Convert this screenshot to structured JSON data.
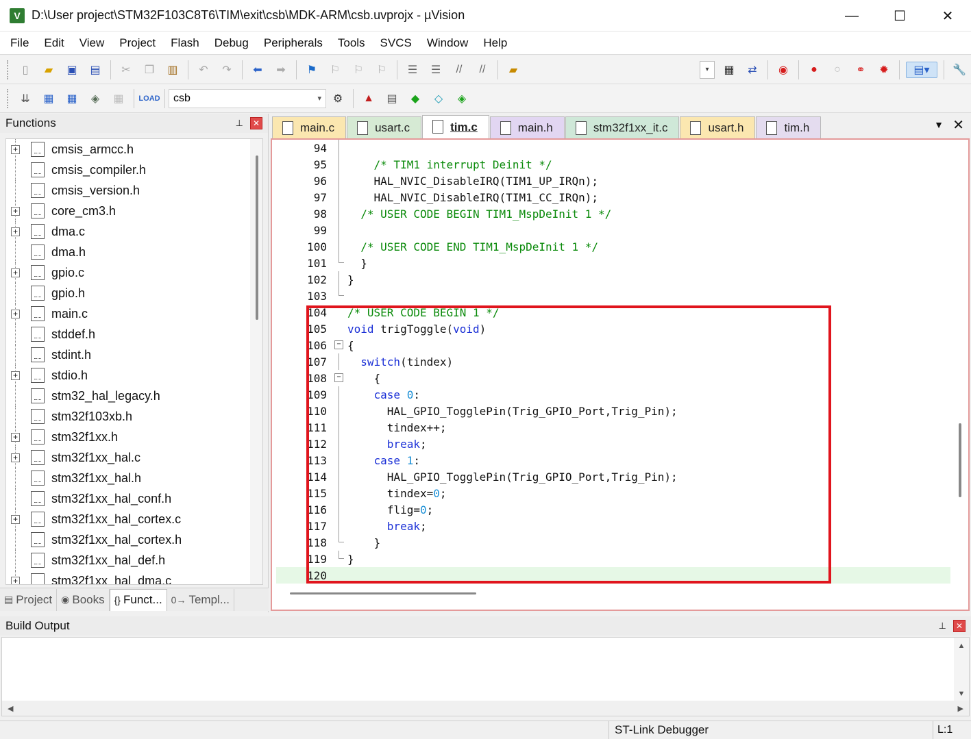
{
  "window": {
    "title": "D:\\User project\\STM32F103C8T6\\TIM\\exit\\csb\\MDK-ARM\\csb.uvprojx - µVision",
    "minimize": "—",
    "maximize": "☐",
    "close": "✕"
  },
  "menu": [
    "File",
    "Edit",
    "View",
    "Project",
    "Flash",
    "Debug",
    "Peripherals",
    "Tools",
    "SVCS",
    "Window",
    "Help"
  ],
  "toolbar": {
    "target_name": "csb"
  },
  "functions_panel": {
    "title": "Functions",
    "pin": "⊥",
    "close": "✕",
    "files": [
      {
        "name": "cmsis_armcc.h",
        "expandable": true
      },
      {
        "name": "cmsis_compiler.h",
        "expandable": false
      },
      {
        "name": "cmsis_version.h",
        "expandable": false
      },
      {
        "name": "core_cm3.h",
        "expandable": true
      },
      {
        "name": "dma.c",
        "expandable": true
      },
      {
        "name": "dma.h",
        "expandable": false
      },
      {
        "name": "gpio.c",
        "expandable": true
      },
      {
        "name": "gpio.h",
        "expandable": false
      },
      {
        "name": "main.c",
        "expandable": true
      },
      {
        "name": "stddef.h",
        "expandable": false
      },
      {
        "name": "stdint.h",
        "expandable": false
      },
      {
        "name": "stdio.h",
        "expandable": true
      },
      {
        "name": "stm32_hal_legacy.h",
        "expandable": false
      },
      {
        "name": "stm32f103xb.h",
        "expandable": false
      },
      {
        "name": "stm32f1xx.h",
        "expandable": true
      },
      {
        "name": "stm32f1xx_hal.c",
        "expandable": true
      },
      {
        "name": "stm32f1xx_hal.h",
        "expandable": false
      },
      {
        "name": "stm32f1xx_hal_conf.h",
        "expandable": false
      },
      {
        "name": "stm32f1xx_hal_cortex.c",
        "expandable": true
      },
      {
        "name": "stm32f1xx_hal_cortex.h",
        "expandable": false
      },
      {
        "name": "stm32f1xx_hal_def.h",
        "expandable": false
      },
      {
        "name": "stm32f1xx_hal_dma.c",
        "expandable": true
      }
    ],
    "tabs": [
      {
        "label": "Project",
        "icon": "▤"
      },
      {
        "label": "Books",
        "icon": "◉"
      },
      {
        "label": "Funct...",
        "icon": "{}"
      },
      {
        "label": "Templ...",
        "icon": "0→"
      }
    ]
  },
  "editor": {
    "tabs": [
      {
        "label": "main.c",
        "color": "#fbe7b0",
        "active": false
      },
      {
        "label": "usart.c",
        "color": "#d6ead4",
        "active": false
      },
      {
        "label": "tim.c",
        "color": "#ffffff",
        "active": true
      },
      {
        "label": "main.h",
        "color": "#e2d6f2",
        "active": false
      },
      {
        "label": "stm32f1xx_it.c",
        "color": "#cfe8d8",
        "active": false
      },
      {
        "label": "usart.h",
        "color": "#fbe7b0",
        "active": false
      },
      {
        "label": "tim.h",
        "color": "#e4dcef",
        "active": false
      }
    ],
    "tab_menu": "▼",
    "tab_close": "✕",
    "lines": [
      {
        "n": "94",
        "fold": "line",
        "segs": []
      },
      {
        "n": "95",
        "fold": "line",
        "segs": [
          {
            "t": "    "
          },
          {
            "t": "/* TIM1 interrupt Deinit */",
            "c": "comment"
          }
        ]
      },
      {
        "n": "96",
        "fold": "line",
        "segs": [
          {
            "t": "    HAL_NVIC_DisableIRQ(TIM1_UP_IRQn);"
          }
        ]
      },
      {
        "n": "97",
        "fold": "line",
        "segs": [
          {
            "t": "    HAL_NVIC_DisableIRQ(TIM1_CC_IRQn);"
          }
        ]
      },
      {
        "n": "98",
        "fold": "line",
        "segs": [
          {
            "t": "  "
          },
          {
            "t": "/* USER CODE BEGIN TIM1_MspDeInit 1 */",
            "c": "comment"
          }
        ]
      },
      {
        "n": "99",
        "fold": "line",
        "segs": []
      },
      {
        "n": "100",
        "fold": "line",
        "segs": [
          {
            "t": "  "
          },
          {
            "t": "/* USER CODE END TIM1_MspDeInit 1 */",
            "c": "comment"
          }
        ]
      },
      {
        "n": "101",
        "fold": "end",
        "segs": [
          {
            "t": "  }"
          }
        ]
      },
      {
        "n": "102",
        "fold": "line",
        "segs": [
          {
            "t": "}"
          }
        ]
      },
      {
        "n": "103",
        "fold": "end",
        "segs": []
      },
      {
        "n": "104",
        "fold": "none",
        "segs": [
          {
            "t": "/* USER CODE BEGIN 1 */",
            "c": "comment"
          }
        ]
      },
      {
        "n": "105",
        "fold": "none",
        "segs": [
          {
            "t": "void",
            "c": "kw"
          },
          {
            "t": " trigToggle("
          },
          {
            "t": "void",
            "c": "kw"
          },
          {
            "t": ")"
          }
        ]
      },
      {
        "n": "106",
        "fold": "box",
        "segs": [
          {
            "t": "{"
          }
        ]
      },
      {
        "n": "107",
        "fold": "line",
        "segs": [
          {
            "t": "  "
          },
          {
            "t": "switch",
            "c": "kw"
          },
          {
            "t": "(tindex)"
          }
        ]
      },
      {
        "n": "108",
        "fold": "box",
        "segs": [
          {
            "t": "    {"
          }
        ]
      },
      {
        "n": "109",
        "fold": "line",
        "segs": [
          {
            "t": "    "
          },
          {
            "t": "case",
            "c": "kw"
          },
          {
            "t": " "
          },
          {
            "t": "0",
            "c": "num"
          },
          {
            "t": ":"
          }
        ]
      },
      {
        "n": "110",
        "fold": "line",
        "segs": [
          {
            "t": "      HAL_GPIO_TogglePin(Trig_GPIO_Port,Trig_Pin);"
          }
        ]
      },
      {
        "n": "111",
        "fold": "line",
        "segs": [
          {
            "t": "      tindex++;"
          }
        ]
      },
      {
        "n": "112",
        "fold": "line",
        "segs": [
          {
            "t": "      "
          },
          {
            "t": "break",
            "c": "kw"
          },
          {
            "t": ";"
          }
        ]
      },
      {
        "n": "113",
        "fold": "line",
        "segs": [
          {
            "t": "    "
          },
          {
            "t": "case",
            "c": "kw"
          },
          {
            "t": " "
          },
          {
            "t": "1",
            "c": "num"
          },
          {
            "t": ":"
          }
        ]
      },
      {
        "n": "114",
        "fold": "line",
        "segs": [
          {
            "t": "      HAL_GPIO_TogglePin(Trig_GPIO_Port,Trig_Pin);"
          }
        ]
      },
      {
        "n": "115",
        "fold": "line",
        "segs": [
          {
            "t": "      tindex="
          },
          {
            "t": "0",
            "c": "num"
          },
          {
            "t": ";"
          }
        ]
      },
      {
        "n": "116",
        "fold": "line",
        "segs": [
          {
            "t": "      flig="
          },
          {
            "t": "0",
            "c": "num"
          },
          {
            "t": ";"
          }
        ]
      },
      {
        "n": "117",
        "fold": "line",
        "segs": [
          {
            "t": "      "
          },
          {
            "t": "break",
            "c": "kw"
          },
          {
            "t": ";"
          }
        ]
      },
      {
        "n": "118",
        "fold": "end",
        "segs": [
          {
            "t": "    }"
          }
        ]
      },
      {
        "n": "119",
        "fold": "end",
        "segs": [
          {
            "t": "}"
          }
        ]
      },
      {
        "n": "120",
        "fold": "none",
        "segs": [],
        "current": true
      }
    ]
  },
  "build_output": {
    "title": "Build Output",
    "pin": "⊥",
    "close": "✕"
  },
  "status": {
    "debugger": "ST-Link Debugger",
    "position": "L:1"
  }
}
